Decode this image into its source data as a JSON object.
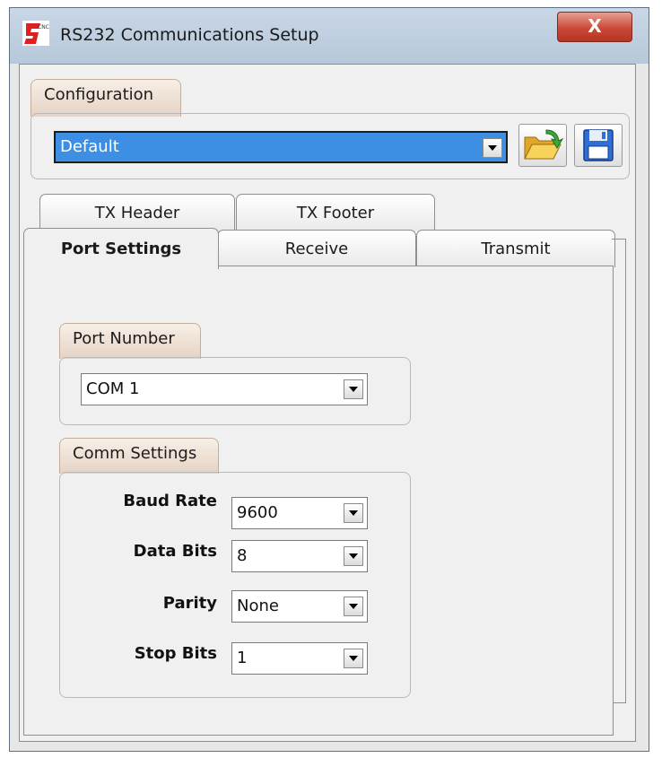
{
  "window": {
    "title": "RS232 Communications Setup",
    "close_glyph": "X",
    "icon_text": "CNC"
  },
  "configuration": {
    "group_label": "Configuration",
    "selected": "Default",
    "open_icon": "folder-open-icon",
    "save_icon": "floppy-disk-icon"
  },
  "tabs": {
    "row_back": [
      "TX Header",
      "TX Footer"
    ],
    "row_front": [
      "Port Settings",
      "Receive",
      "Transmit"
    ],
    "active": "Port Settings"
  },
  "port_number": {
    "group_label": "Port Number",
    "selected": "COM 1"
  },
  "comm_settings": {
    "group_label": "Comm Settings",
    "fields": [
      {
        "label": "Baud Rate",
        "value": "9600"
      },
      {
        "label": "Data Bits",
        "value": "8"
      },
      {
        "label": "Parity",
        "value": "None"
      },
      {
        "label": "Stop Bits",
        "value": "1"
      }
    ]
  },
  "colors": {
    "selection_blue": "#3c8fe3",
    "close_red": "#c9493a",
    "group_tab": "#e5d3c3"
  }
}
